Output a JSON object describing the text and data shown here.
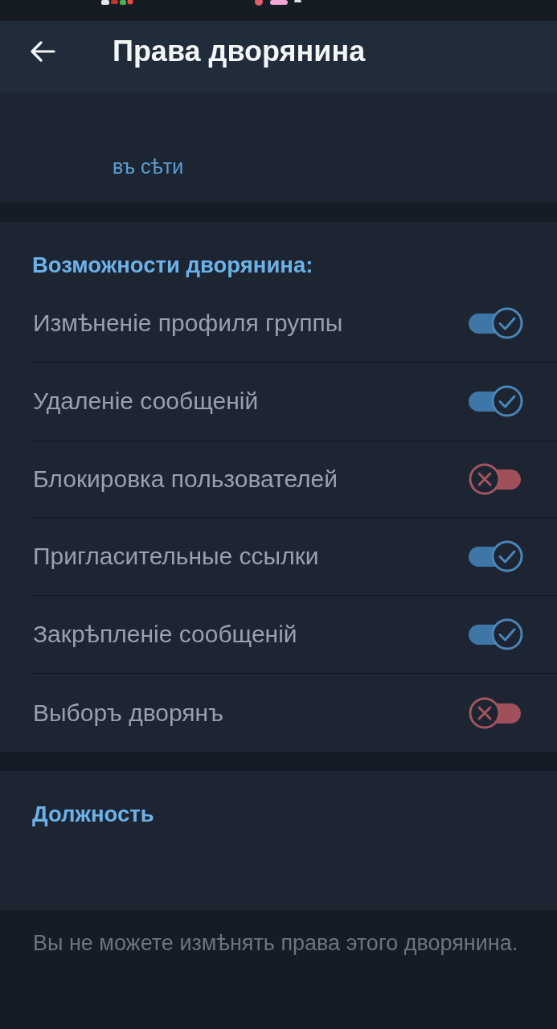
{
  "header": {
    "title": "Права дворянина"
  },
  "profile": {
    "status": "въ сѣти"
  },
  "permissions": {
    "title": "Возможности дворянина:",
    "items": [
      {
        "label": "Измѣненіе профиля группы",
        "on": true
      },
      {
        "label": "Удаленіе сообщеній",
        "on": true
      },
      {
        "label": "Блокировка пользователей",
        "on": false
      },
      {
        "label": "Пригласительные ссылки",
        "on": true
      },
      {
        "label": "Закрѣпленіе сообщеній",
        "on": true
      },
      {
        "label": "Выборъ дворянъ",
        "on": false
      }
    ]
  },
  "position": {
    "title": "Должность"
  },
  "footer_note": "Вы не можете измѣнять права этого дворянина."
}
